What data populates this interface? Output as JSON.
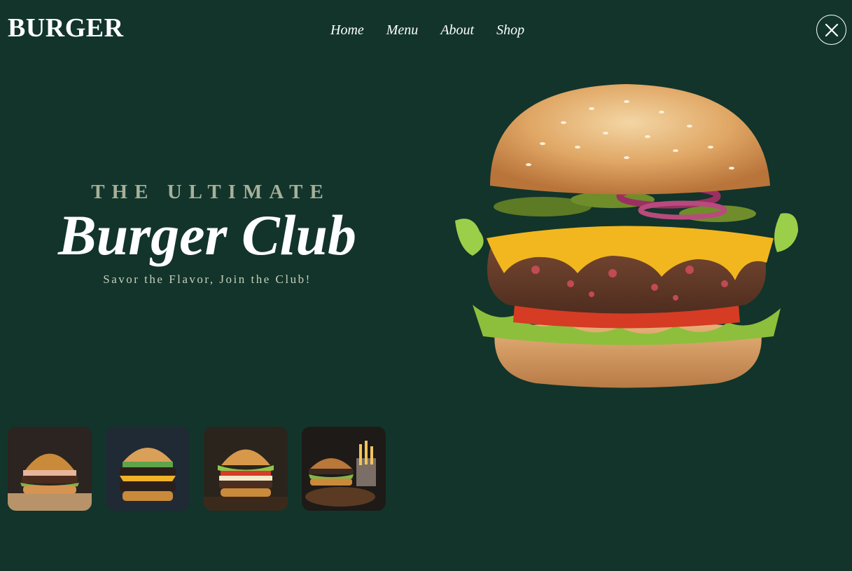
{
  "brand": {
    "logo_text": "BURGER"
  },
  "nav": {
    "items": [
      {
        "label": "Home"
      },
      {
        "label": "Menu"
      },
      {
        "label": "About"
      },
      {
        "label": "Shop"
      }
    ]
  },
  "close_icon": "close-icon",
  "hero": {
    "eyebrow": "THE ULTIMATE",
    "headline": "Burger Club",
    "tagline": "Savor the Flavor, Join the Club!",
    "image_icon": "burger-hero-image"
  },
  "gallery": {
    "thumbnails": [
      {
        "name": "burger-thumb-1"
      },
      {
        "name": "burger-thumb-2"
      },
      {
        "name": "burger-thumb-3"
      },
      {
        "name": "burger-thumb-4"
      }
    ]
  },
  "colors": {
    "background": "#12342b",
    "accent_text": "#a7b09a",
    "text": "#ffffff"
  }
}
